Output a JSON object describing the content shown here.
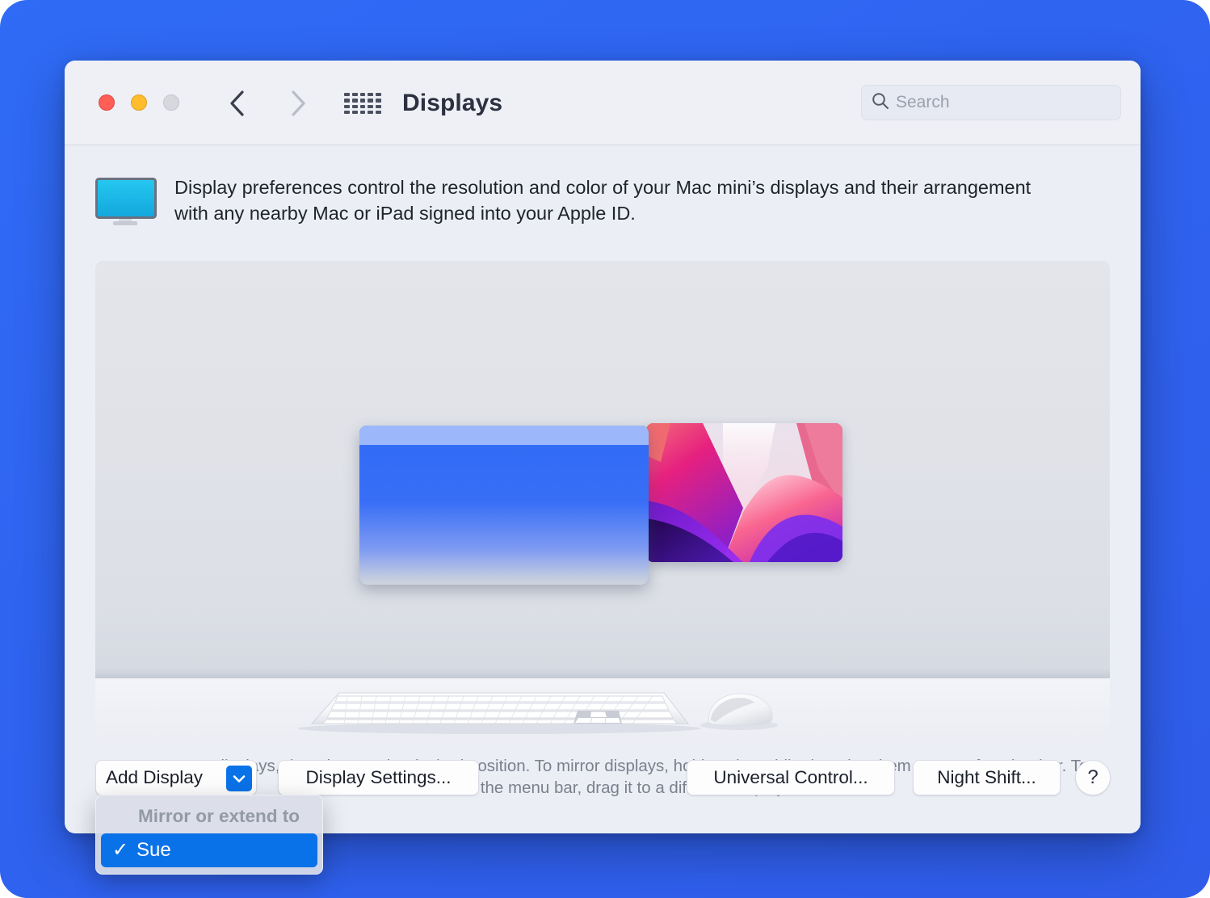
{
  "window": {
    "title": "Displays",
    "traffic_lights": [
      "close",
      "minimize",
      "maximize"
    ]
  },
  "toolbar": {
    "back_icon": "chevron-left-icon",
    "forward_icon": "chevron-right-icon",
    "show_all_icon": "grid-dots-icon",
    "title": "Displays",
    "search": {
      "icon": "search-icon",
      "placeholder": "Search",
      "value": ""
    }
  },
  "description": {
    "icon": "display-monitor-icon",
    "text": "Display preferences control the resolution and color of your Mac mini’s displays and their arrangement with any nearby Mac or iPad signed into your Apple ID."
  },
  "arrangement": {
    "displays": [
      {
        "name": "primary-display",
        "role": "main",
        "has_menu_bar": true,
        "wallpaper": "blue-gradient"
      },
      {
        "name": "secondary-display",
        "role": "extended",
        "has_menu_bar": false,
        "wallpaper": "monterey-pink-purple"
      }
    ],
    "peripherals": [
      "magic-keyboard",
      "magic-mouse"
    ],
    "hint": "To rearrange displays, drag them to the desired position. To mirror displays, hold Option while dragging them on top of each other. To relocate the menu bar, drag it to a different display."
  },
  "bottom_bar": {
    "add_display_label": "Add Display",
    "add_display_chevron_icon": "chevron-down-icon",
    "display_settings_label": "Display Settings...",
    "universal_control_label": "Universal Control...",
    "night_shift_label": "Night Shift...",
    "help_label": "?"
  },
  "add_display_menu": {
    "open": true,
    "header": "Mirror or extend to",
    "items": [
      {
        "label": "Sue",
        "checked": true,
        "checkmark": "✓"
      }
    ]
  },
  "colors": {
    "desktop_background": "#2f63f0",
    "window_background": "#ebeef5",
    "toolbar_background": "#eef0f6",
    "accent_blue": "#0a72e8",
    "traffic_close": "#ff5f57",
    "traffic_minimize": "#febc2e",
    "traffic_maximize": "#d6d8dd",
    "monitor_icon": "#1ec0ec",
    "hint_text": "#7b808d"
  }
}
